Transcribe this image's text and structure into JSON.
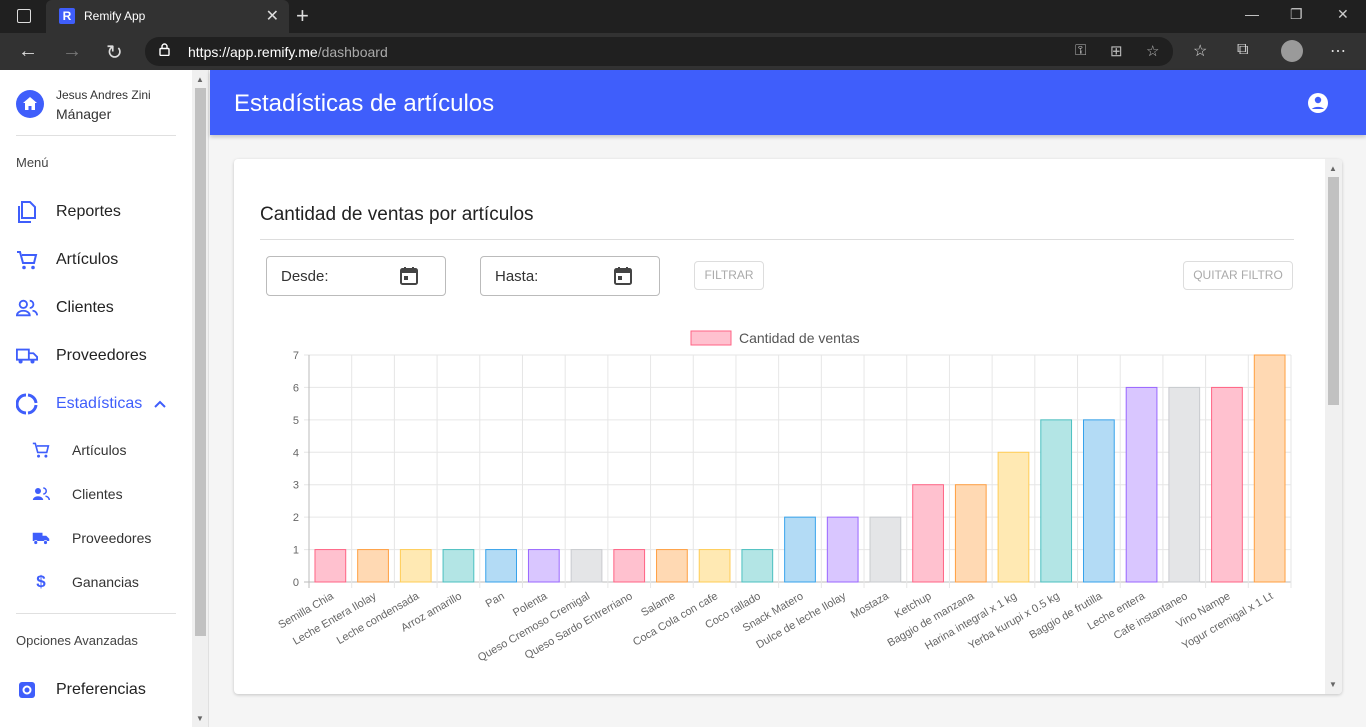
{
  "browser": {
    "tab_title": "Remify App",
    "favicon_letter": "R",
    "url_host": "https://app.remify.me",
    "url_path": "/dashboard"
  },
  "sidebar": {
    "user_name": "Jesus Andres Zini",
    "user_role": "Mánager",
    "menu_title": "Menú",
    "items": [
      {
        "label": "Reportes",
        "icon": "file-copy-icon"
      },
      {
        "label": "Artículos",
        "icon": "cart-icon"
      },
      {
        "label": "Clientes",
        "icon": "people-icon"
      },
      {
        "label": "Proveedores",
        "icon": "truck-icon"
      },
      {
        "label": "Estadísticas",
        "icon": "donut-chart-icon"
      }
    ],
    "subitems": [
      {
        "label": "Artículos",
        "icon": "cart-icon"
      },
      {
        "label": "Clientes",
        "icon": "people-icon"
      },
      {
        "label": "Proveedores",
        "icon": "truck-icon"
      },
      {
        "label": "Ganancias",
        "icon": "dollar-icon"
      }
    ],
    "advanced_title": "Opciones Avanzadas",
    "preferences": "Preferencias"
  },
  "header": {
    "title": "Estadísticas de artículos"
  },
  "card": {
    "title": "Cantidad de ventas por artículos",
    "from_label": "Desde:",
    "to_label": "Hasta:",
    "filter_button": "FILTRAR",
    "clear_button": "QUITAR FILTRO"
  },
  "colors": {
    "brand": "#3f5efb"
  },
  "chart_data": {
    "type": "bar",
    "legend": "Cantidad de ventas",
    "legend_position": "top",
    "grid": true,
    "ylim": [
      0,
      7
    ],
    "yticks": [
      0,
      1,
      2,
      3,
      4,
      5,
      6,
      7
    ],
    "categories": [
      "Semilla Chia",
      "Leche Entera Ilolay",
      "Leche condensada",
      "Arroz amarillo",
      "Pan",
      "Polenta",
      "Queso Cremoso Cremigal",
      "Queso Sardo Entrerriano",
      "Salame",
      "Coca Cola con cafe",
      "Coco rallado",
      "Snack Matero",
      "Dulce de leche Ilolay",
      "Mostaza",
      "Ketchup",
      "Baggio de manzana",
      "Harina integral x 1 kg",
      "Yerba kurupi x 0.5 kg",
      "Baggio de frutilla",
      "Leche entera",
      "Cafe instantaneo",
      "Vino Nampe",
      "Yogur cremigal x 1 Lt"
    ],
    "values": [
      1,
      1,
      1,
      1,
      1,
      1,
      1,
      1,
      1,
      1,
      1,
      2,
      2,
      2,
      3,
      3,
      4,
      5,
      5,
      6,
      6,
      6,
      7
    ],
    "palette": [
      {
        "fill": "#ffc1cf",
        "stroke": "#ff6384"
      },
      {
        "fill": "#ffd9b3",
        "stroke": "#ff9f40"
      },
      {
        "fill": "#ffe9b3",
        "stroke": "#ffcd56"
      },
      {
        "fill": "#b3e5e5",
        "stroke": "#4bc0c0"
      },
      {
        "fill": "#b3dbf5",
        "stroke": "#36a2eb"
      },
      {
        "fill": "#d9c6ff",
        "stroke": "#9966ff"
      },
      {
        "fill": "#e4e5e7",
        "stroke": "#c9cbcf"
      }
    ]
  }
}
